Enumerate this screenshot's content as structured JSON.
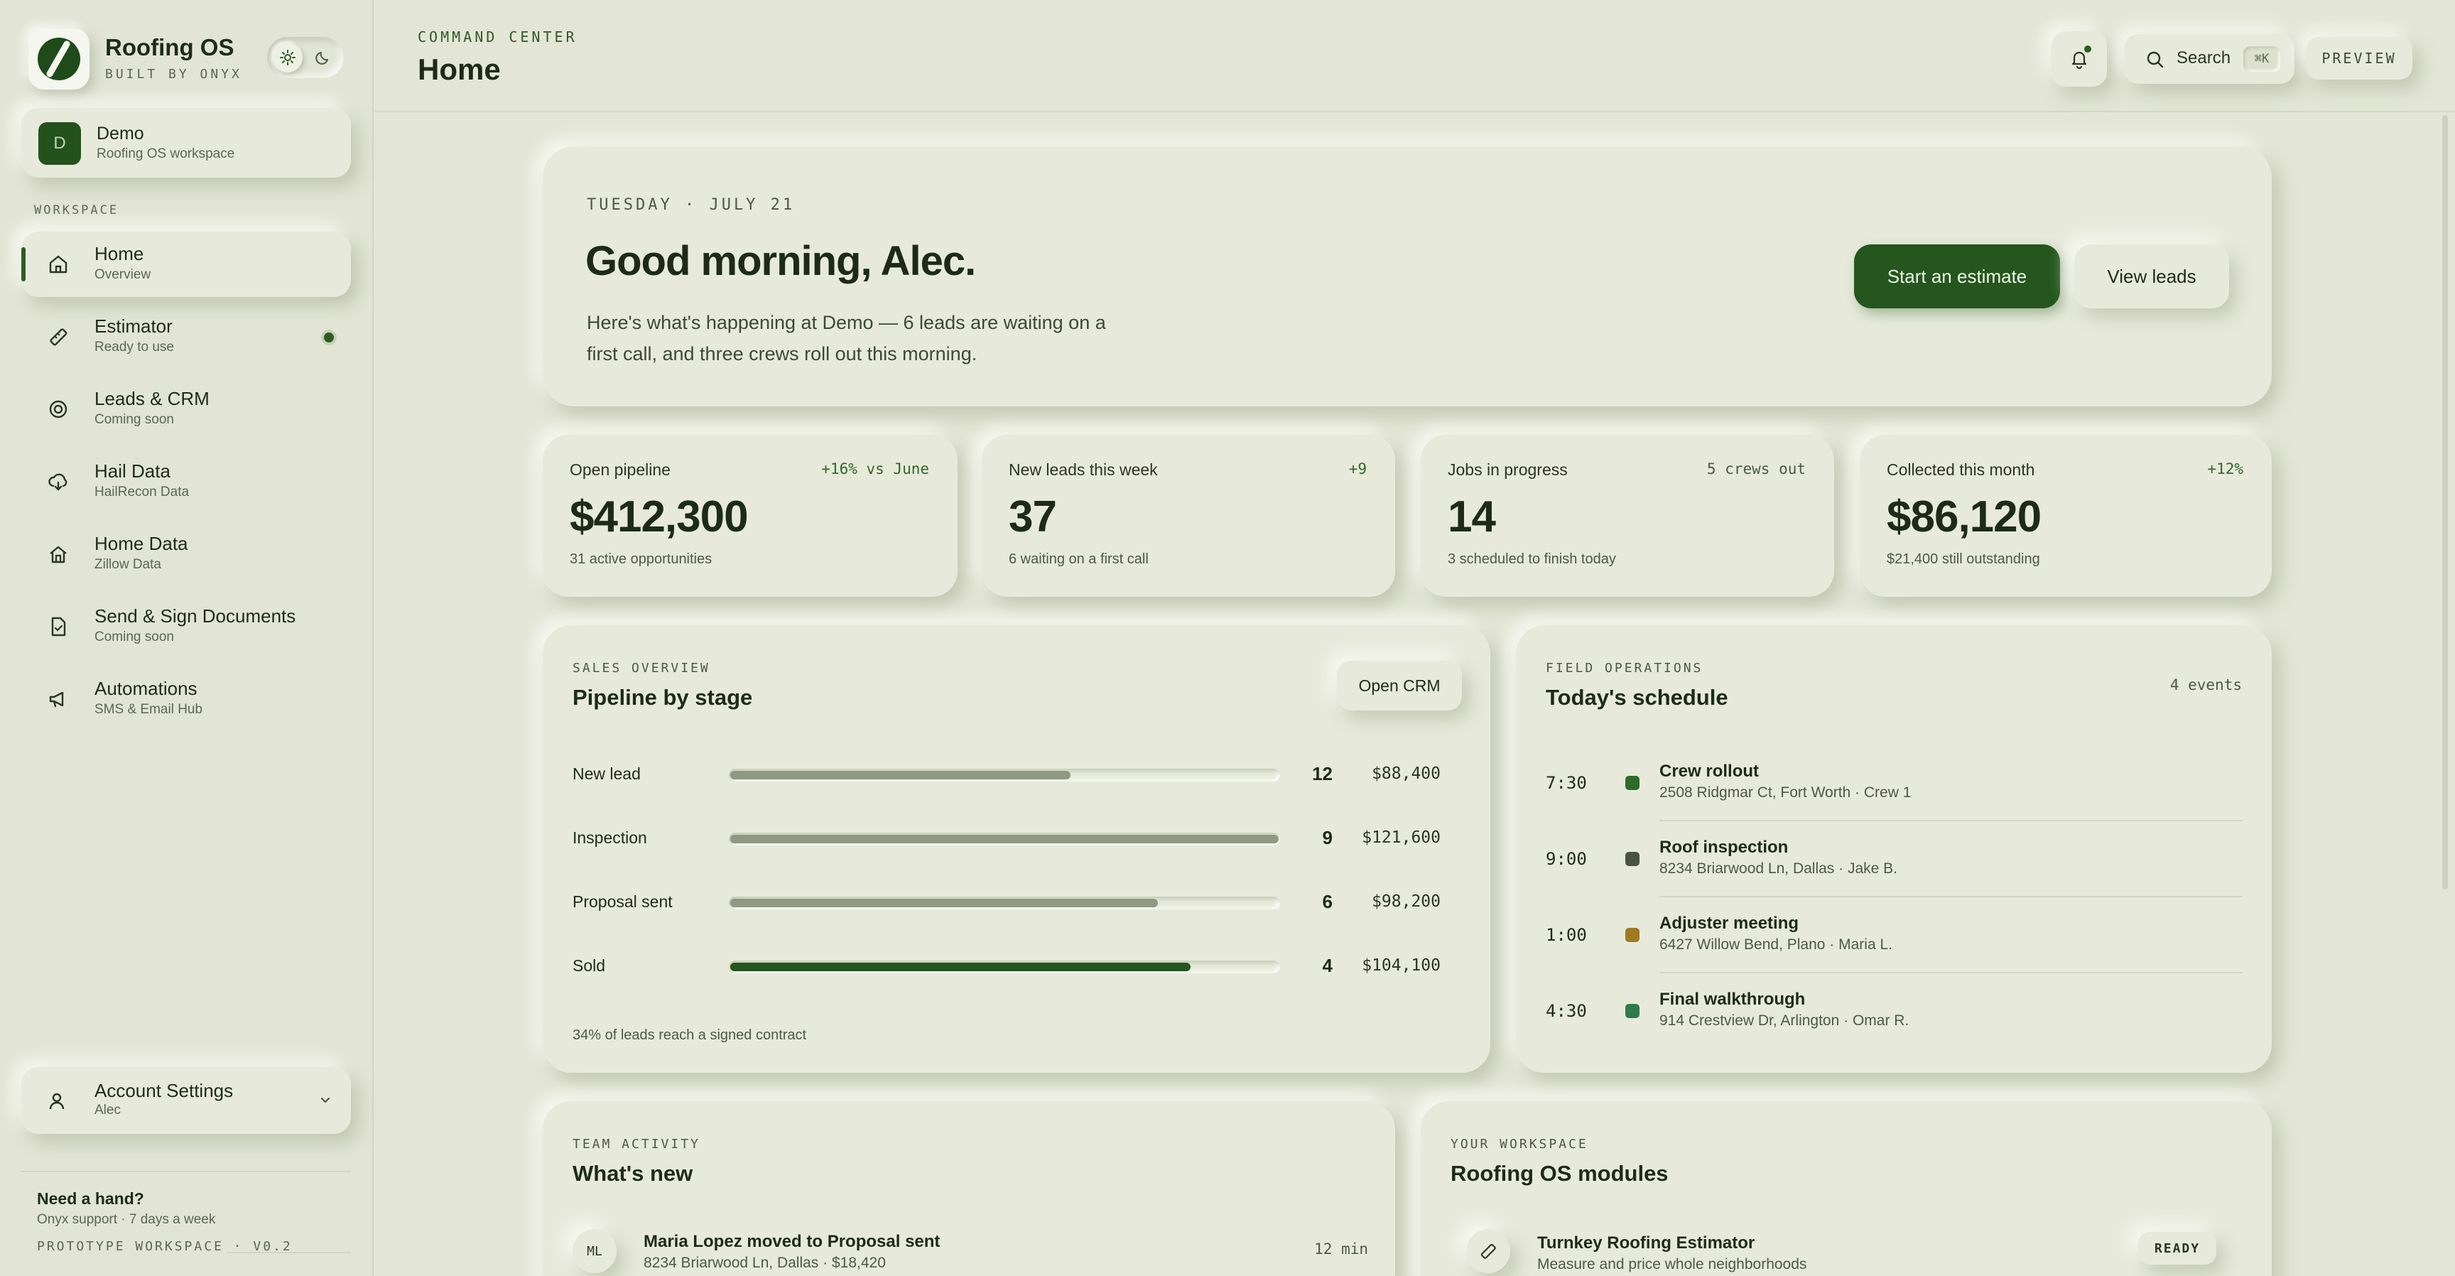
{
  "brand": {
    "title": "Roofing OS",
    "subtitle": "BUILT BY ONYX"
  },
  "workspace": {
    "avatar": "D",
    "name": "Demo",
    "subtitle": "Roofing OS workspace"
  },
  "sidebar": {
    "section_label": "WORKSPACE",
    "items": [
      {
        "label": "Home",
        "sub": "Overview",
        "icon": "home-icon",
        "active": true
      },
      {
        "label": "Estimator",
        "sub": "Ready to use",
        "icon": "ruler-icon",
        "badge": true
      },
      {
        "label": "Leads & CRM",
        "sub": "Coming soon",
        "icon": "target-icon"
      },
      {
        "label": "Hail Data",
        "sub": "HailRecon Data",
        "icon": "cloud-icon"
      },
      {
        "label": "Home Data",
        "sub": "Zillow Data",
        "icon": "house-icon"
      },
      {
        "label": "Send & Sign Documents",
        "sub": "Coming soon",
        "icon": "document-icon"
      },
      {
        "label": "Automations",
        "sub": "SMS & Email Hub",
        "icon": "megaphone-icon"
      }
    ],
    "account": {
      "label": "Account Settings",
      "sub": "Alec"
    },
    "help": {
      "title": "Need a hand?",
      "sub": "Onyx support · 7 days a week",
      "version": "PROTOTYPE WORKSPACE · V0.2"
    }
  },
  "header": {
    "crumb": "COMMAND CENTER",
    "title": "Home",
    "search_label": "Search",
    "search_shortcut": "⌘K",
    "preview_label": "PREVIEW"
  },
  "hero": {
    "date": "TUESDAY · JULY 21",
    "greeting": "Good morning, Alec.",
    "message": "Here's what's happening at Demo — 6 leads are waiting on a first call, and three crews roll out this morning.",
    "primary_button": "Start an estimate",
    "secondary_button": "View leads"
  },
  "stats": [
    {
      "label": "Open pipeline",
      "delta": "+16% vs June",
      "value": "$412,300",
      "sub": "31 active opportunities"
    },
    {
      "label": "New leads this week",
      "delta": "+9",
      "value": "37",
      "sub": "6 waiting on a first call"
    },
    {
      "label": "Jobs in progress",
      "delta": "5 crews out",
      "value": "14",
      "sub": "3 scheduled to finish today"
    },
    {
      "label": "Collected this month",
      "delta": "+12%",
      "value": "$86,120",
      "sub": "$21,400 still outstanding"
    }
  ],
  "pipeline": {
    "kicker": "SALES OVERVIEW",
    "title": "Pipeline by stage",
    "button": "Open CRM",
    "stages": [
      {
        "name": "New lead",
        "count": "12",
        "amount": "$88,400",
        "fill": 0.62
      },
      {
        "name": "Inspection",
        "count": "9",
        "amount": "$121,600",
        "fill": 1.0
      },
      {
        "name": "Proposal sent",
        "count": "6",
        "amount": "$98,200",
        "fill": 0.78
      },
      {
        "name": "Sold",
        "count": "4",
        "amount": "$104,100",
        "fill": 0.84
      }
    ],
    "note": "34% of leads reach a signed contract"
  },
  "schedule": {
    "kicker": "FIELD OPERATIONS",
    "title": "Today's schedule",
    "count": "4 events",
    "events": [
      {
        "time": "7:30",
        "title": "Crew rollout",
        "sub": "2508 Ridgmar Ct, Fort Worth · Crew 1",
        "color": "#2f6a2a"
      },
      {
        "time": "9:00",
        "title": "Roof inspection",
        "sub": "8234 Briarwood Ln, Dallas · Jake B.",
        "color": "#4a5244"
      },
      {
        "time": "1:00",
        "title": "Adjuster meeting",
        "sub": "6427 Willow Bend, Plano · Maria L.",
        "color": "#a07a22"
      },
      {
        "time": "4:30",
        "title": "Final walkthrough",
        "sub": "914 Crestview Dr, Arlington · Omar R.",
        "color": "#2f7a4a"
      }
    ]
  },
  "activity": {
    "kicker": "TEAM ACTIVITY",
    "title": "What's new",
    "items": [
      {
        "initials": "ML",
        "title": "Maria Lopez moved to Proposal sent",
        "sub": "8234 Briarwood Ln, Dallas · $18,420",
        "time": "12 min"
      }
    ]
  },
  "modules": {
    "kicker": "YOUR WORKSPACE",
    "title": "Roofing OS modules",
    "items": [
      {
        "title": "Turnkey Roofing Estimator",
        "sub": "Measure and price whole neighborhoods",
        "status": "READY"
      }
    ]
  }
}
